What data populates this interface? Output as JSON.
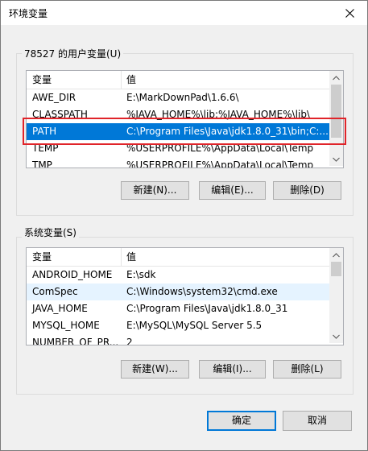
{
  "window": {
    "title": "环境变量",
    "close_icon": "close-icon"
  },
  "user_vars": {
    "group_label": "78527 的用户变量(U)",
    "columns": [
      "变量",
      "值"
    ],
    "rows": [
      {
        "name": "AWE_DIR",
        "value": "E:\\MarkDownPad\\1.6.6\\"
      },
      {
        "name": "CLASSPATH",
        "value": "%JAVA_HOME%\\lib;%JAVA_HOME%\\lib\\"
      },
      {
        "name": "PATH",
        "value": "C:\\Program Files\\Java\\jdk1.8.0_31\\bin;C:..."
      },
      {
        "name": "TEMP",
        "value": "%USERPROFILE%\\AppData\\Local\\Temp"
      },
      {
        "name": "TMP",
        "value": "%USERPROFILE%\\AppData\\Local\\Temp"
      }
    ],
    "selected_index": 2,
    "buttons": {
      "new": "新建(N)...",
      "edit": "编辑(E)...",
      "delete": "删除(D)"
    }
  },
  "system_vars": {
    "group_label": "系统变量(S)",
    "columns": [
      "变量",
      "值"
    ],
    "rows": [
      {
        "name": "ANDROID_HOME",
        "value": "E:\\sdk"
      },
      {
        "name": "ComSpec",
        "value": "C:\\Windows\\system32\\cmd.exe"
      },
      {
        "name": "JAVA_HOME",
        "value": "C:\\Program Files\\Java\\jdk1.8.0_31"
      },
      {
        "name": "MYSQL_HOME",
        "value": "E:\\MySQL\\MySQL Server 5.5"
      },
      {
        "name": "NUMBER_OF_PR...",
        "value": "2"
      }
    ],
    "hover_index": 1,
    "buttons": {
      "new": "新建(W)...",
      "edit": "编辑(I)...",
      "delete": "删除(L)"
    }
  },
  "footer": {
    "ok": "确定",
    "cancel": "取消"
  },
  "colors": {
    "selection": "#0078d7",
    "annotation": "#e0242a"
  }
}
